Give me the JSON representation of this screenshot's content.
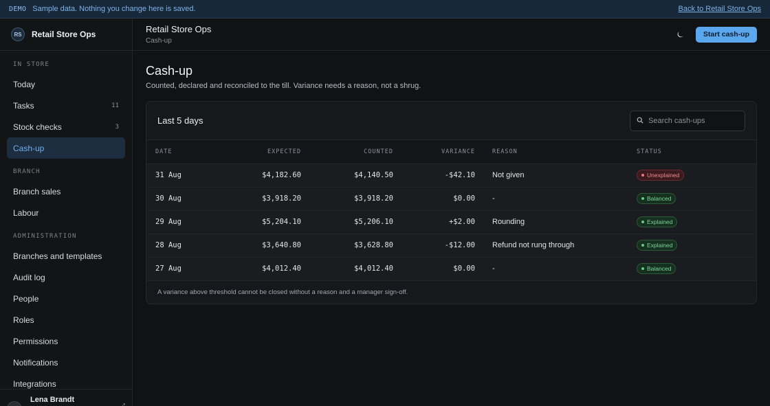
{
  "banner": {
    "tag": "DEMO",
    "text": "Sample data. Nothing you change here is saved.",
    "back_link": "Back to Retail Store Ops"
  },
  "sidebar": {
    "avatar_initials": "RS",
    "brand": "Retail Store Ops",
    "sections": [
      {
        "label": "IN STORE",
        "items": [
          {
            "label": "Today",
            "count": ""
          },
          {
            "label": "Tasks",
            "count": "11"
          },
          {
            "label": "Stock checks",
            "count": "3"
          },
          {
            "label": "Cash-up",
            "count": "",
            "active": true
          }
        ]
      },
      {
        "label": "BRANCH",
        "items": [
          {
            "label": "Branch sales",
            "count": ""
          },
          {
            "label": "Labour",
            "count": ""
          }
        ]
      },
      {
        "label": "ADMINISTRATION",
        "items": [
          {
            "label": "Branches and templates",
            "count": ""
          },
          {
            "label": "Audit log",
            "count": ""
          },
          {
            "label": "People",
            "count": ""
          },
          {
            "label": "Roles",
            "count": ""
          },
          {
            "label": "Permissions",
            "count": ""
          },
          {
            "label": "Notifications",
            "count": ""
          },
          {
            "label": "Integrations",
            "count": ""
          }
        ]
      }
    ],
    "user": {
      "initials": "LB",
      "name": "Lena Brandt"
    }
  },
  "header": {
    "title": "Retail Store Ops",
    "subtitle": "Cash-up",
    "theme_icon": "moon-icon",
    "primary_button": "Start cash-up"
  },
  "page": {
    "title": "Cash-up",
    "description": "Counted, declared and reconciled to the till. Variance needs a reason, not a shrug."
  },
  "card": {
    "title": "Last 5 days",
    "search_placeholder": "Search cash-ups",
    "columns": [
      "DATE",
      "EXPECTED",
      "COUNTED",
      "VARIANCE",
      "REASON",
      "STATUS"
    ],
    "rows": [
      {
        "date": "31 Aug",
        "expected": "$4,182.60",
        "counted": "$4,140.50",
        "variance": "-$42.10",
        "reason": "Not given",
        "status": "Unexplained",
        "tone": "red"
      },
      {
        "date": "30 Aug",
        "expected": "$3,918.20",
        "counted": "$3,918.20",
        "variance": "$0.00",
        "reason": "-",
        "status": "Balanced",
        "tone": "green"
      },
      {
        "date": "29 Aug",
        "expected": "$5,204.10",
        "counted": "$5,206.10",
        "variance": "+$2.00",
        "reason": "Rounding",
        "status": "Explained",
        "tone": "green"
      },
      {
        "date": "28 Aug",
        "expected": "$3,640.80",
        "counted": "$3,628.80",
        "variance": "-$12.00",
        "reason": "Refund not rung through",
        "status": "Explained",
        "tone": "green"
      },
      {
        "date": "27 Aug",
        "expected": "$4,012.40",
        "counted": "$4,012.40",
        "variance": "$0.00",
        "reason": "-",
        "status": "Balanced",
        "tone": "green"
      }
    ],
    "footnote": "A variance above threshold cannot be closed without a reason and a manager sign-off."
  },
  "colors": {
    "accent": "#5aa7ee",
    "active_nav_bg": "#1c2d40",
    "status_red": "#f07680",
    "status_green": "#5fcf84"
  }
}
